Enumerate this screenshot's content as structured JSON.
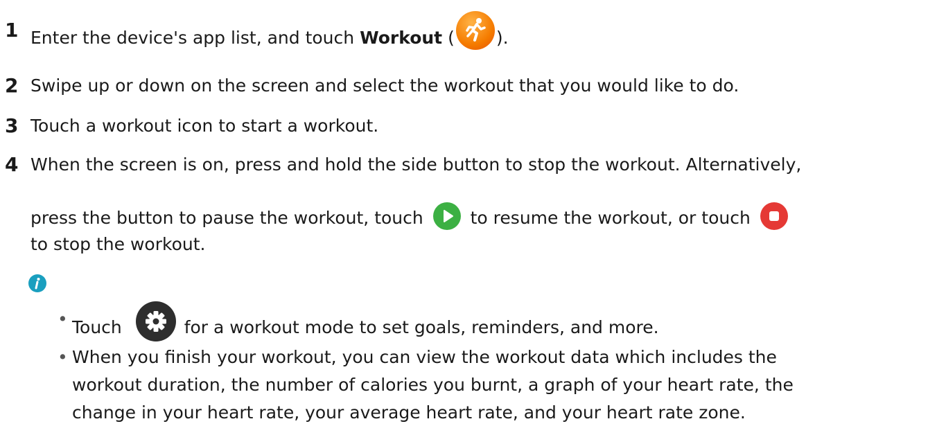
{
  "steps": [
    {
      "number": "1",
      "text_before": "Enter the device's app list, and touch ",
      "bold": "Workout",
      "text_open": " (",
      "text_close": ")."
    },
    {
      "number": "2",
      "text": "Swipe up or down on the screen and select the workout that you would like to do."
    },
    {
      "number": "3",
      "text": "Touch a workout icon to start a workout."
    },
    {
      "number": "4",
      "line1": "When the screen is on, press and hold the side button to stop the workout. Alternatively,",
      "line2_a": "press the button to pause the workout, touch ",
      "line2_b": " to resume the workout, or touch ",
      "line3": "to stop the workout."
    }
  ],
  "note": {
    "bullet1_a": "Touch ",
    "bullet1_b": "for a workout mode to set goals, reminders, and more.",
    "bullet2_line1": "When you finish your workout, you can view the workout data which includes the",
    "bullet2_line2": "workout duration, the number of calories you burnt, a graph of your heart rate, the",
    "bullet2_line3": "change in your heart rate, your average heart rate, and your heart rate zone.",
    "bullet_symbol": "•"
  },
  "icons": {
    "workout": "running-person-icon",
    "resume": "play-icon",
    "stop": "stop-icon",
    "settings": "gear-icon",
    "note": "info-icon"
  },
  "colors": {
    "workout_orange": "#f57c00",
    "play_green": "#3cb043",
    "stop_red": "#e53935",
    "info_teal": "#1a9fbf"
  }
}
